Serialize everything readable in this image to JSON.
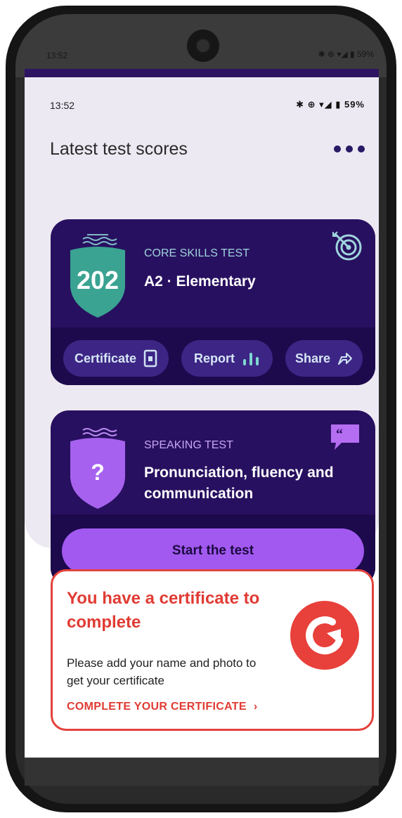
{
  "device": {
    "top_status": {
      "time": "13:52",
      "icons": "✱ ⊕ ▾◢ ▮ 59%"
    }
  },
  "status_bar": {
    "time": "13:52",
    "icons": "✱ ⊕ ▾◢ ▮ 59%"
  },
  "header": {
    "title": "Latest test scores",
    "more_icon": "more-horizontal-icon"
  },
  "core_card": {
    "label": "CORE SKILLS TEST",
    "score": "202",
    "level": "A2 · Elementary",
    "actions": [
      {
        "label": "Certificate",
        "icon": "certificate-icon"
      },
      {
        "label": "Report",
        "icon": "bar-chart-icon"
      },
      {
        "label": "Share",
        "icon": "share-icon"
      }
    ],
    "colors": {
      "shield": "#3aa391",
      "label": "#9fd4dc"
    }
  },
  "speaking_card": {
    "label": "SPEAKING TEST",
    "score": "?",
    "heading": "Pronunciation, fluency and communication",
    "button": "Start the test",
    "colors": {
      "shield": "#a662ee",
      "button": "#a259f0"
    }
  },
  "certificate_promo": {
    "title": "You have a certificate to complete",
    "description": "Please add your name and photo to get your certificate",
    "link": "COMPLETE YOUR CERTIFICATE",
    "link_arrow": "›",
    "badge_icon": "refresh-arrow-icon",
    "colors": {
      "accent": "#e3423c"
    }
  }
}
